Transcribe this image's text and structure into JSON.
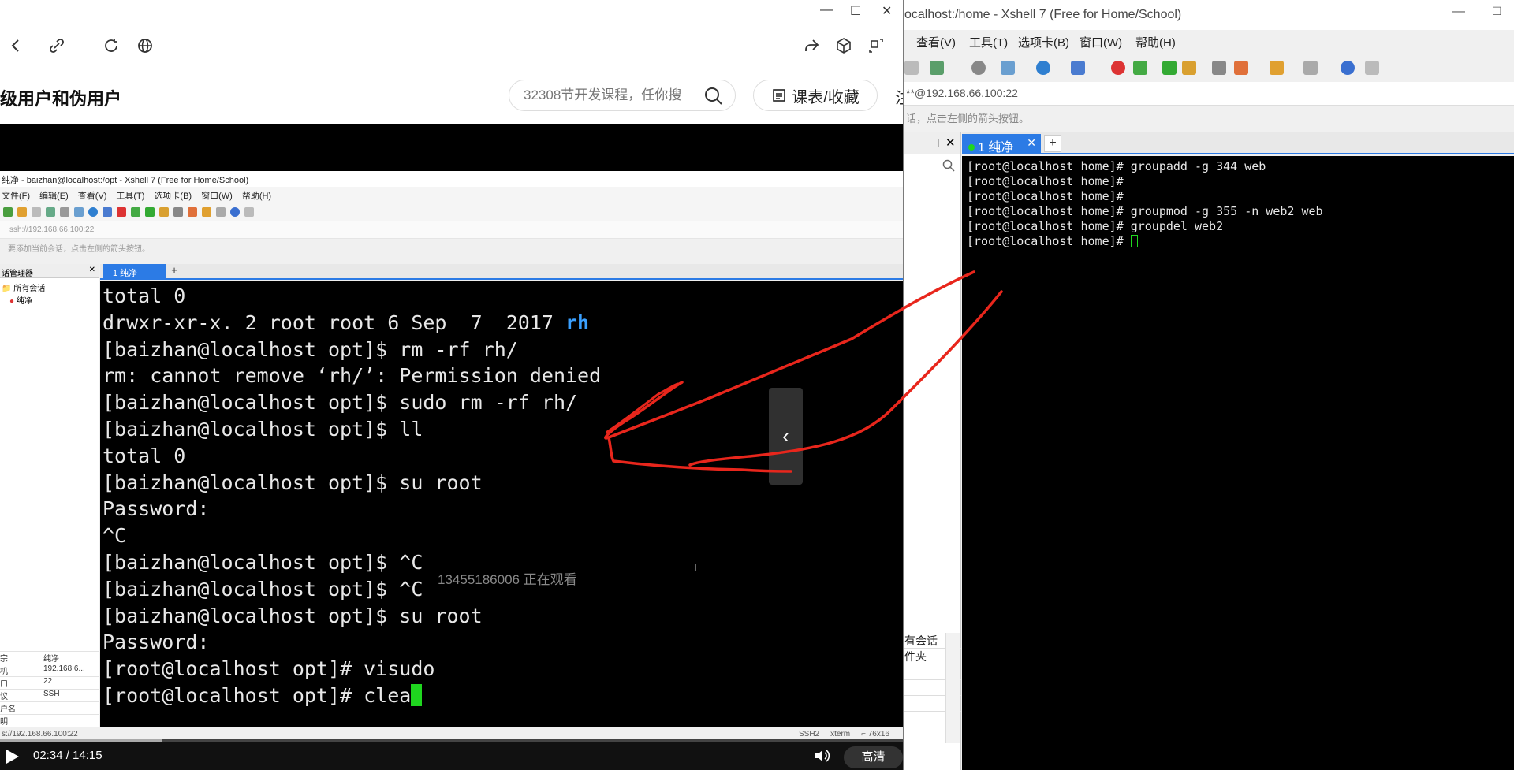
{
  "browser": {
    "window_controls": {
      "minimize": "—",
      "maximize": "☐",
      "close": "✕"
    },
    "page_title": "级用户和伪用户",
    "search": {
      "placeholder": "32308节开发课程，任你搜"
    },
    "course_button": "课表/收藏",
    "cut_char": "注",
    "toolbar_icons": [
      "back-icon",
      "link-icon",
      "refresh-icon",
      "globe-icon",
      "share-icon",
      "cube-icon",
      "screenshot-icon"
    ]
  },
  "video": {
    "inner_xshell": {
      "title": "纯净 - baizhan@localhost:/opt - Xshell 7 (Free for Home/School)",
      "menu": [
        "文件(F)",
        "编辑(E)",
        "查看(V)",
        "工具(T)",
        "选项卡(B)",
        "窗口(W)",
        "帮助(H)"
      ],
      "address": "ssh://192.168.66.100:22",
      "hint": "要添加当前会话，点击左侧的箭头按钮。",
      "session_panel_title": "话管理器",
      "tree": [
        "所有会话",
        "纯净"
      ],
      "properties": [
        {
          "k": "宗",
          "v": "纯净"
        },
        {
          "k": "机",
          "v": "192.168.6..."
        },
        {
          "k": "口",
          "v": "22"
        },
        {
          "k": "议",
          "v": "SSH"
        },
        {
          "k": "户名",
          "v": ""
        },
        {
          "k": "明",
          "v": ""
        }
      ],
      "tab_label": "1 纯净",
      "terminal_lines": [
        "total 0",
        "drwxr-xr-x. 2 root root 6 Sep  7  2017 ",
        "[baizhan@localhost opt]$ rm -rf rh/",
        "rm: cannot remove ‘rh/’: Permission denied",
        "[baizhan@localhost opt]$ sudo rm -rf rh/",
        "[baizhan@localhost opt]$ ll",
        "total 0",
        "[baizhan@localhost opt]$ su root",
        "Password:",
        "^C",
        "[baizhan@localhost opt]$ ^C",
        "[baizhan@localhost opt]$ ^C",
        "[baizhan@localhost opt]$ su root",
        "Password:",
        "[root@localhost opt]# visudo",
        "[root@localhost opt]# clea"
      ],
      "dir_highlight": "rh",
      "status_left": "s://192.168.66.100:22",
      "status_right": [
        "SSH2",
        "xterm",
        "⌐ 76x16"
      ]
    },
    "watching_overlay": "13455186006 正在观看",
    "ibeam": "I",
    "prev_arrow": "‹",
    "time": "02:34 / 14:15",
    "progress": 0.18,
    "quality": "高清"
  },
  "xshell": {
    "title": "ocalhost:/home - Xshell 7 (Free for Home/School)",
    "min": "—",
    "max": "☐",
    "menu": [
      "查看(V)",
      "工具(T)",
      "选项卡(B)",
      "窗口(W)",
      "帮助(H)"
    ],
    "address": "**@192.168.66.100:22",
    "hint": "话，点击左侧的箭头按钮。",
    "tab_label": "1 纯净",
    "tab_close": "✕",
    "tab_plus": "+",
    "pin": "⊣",
    "panel_close": "✕",
    "side_props": [
      "有会话",
      "件夹"
    ],
    "terminal_lines": [
      "[root@localhost home]# groupadd -g 344 web",
      "[root@localhost home]#",
      "[root@localhost home]#",
      "[root@localhost home]# groupmod -g 355 -n web2 web",
      "[root@localhost home]# groupdel web2",
      "[root@localhost home]# "
    ]
  },
  "colors": {
    "terminal_bg": "#000000",
    "tab_blue": "#2c7be5",
    "cursor_green": "#1fd61f",
    "annotation_red": "#e8261c",
    "dir_blue": "#3aa0ff"
  }
}
